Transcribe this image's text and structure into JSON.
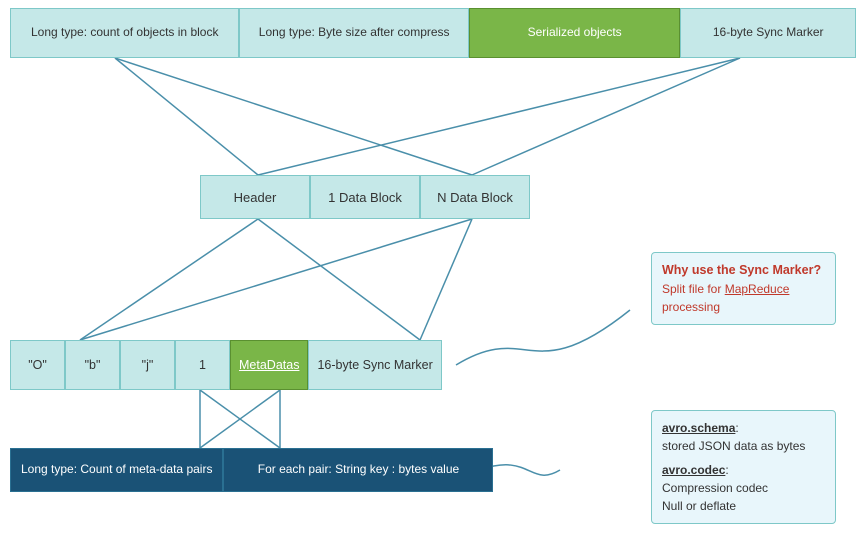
{
  "top_bar": {
    "cell1": "Long type:\ncount of objects in block",
    "cell2": "Long type:\nByte size after compress",
    "cell3": "Serialized objects",
    "cell4": "16-byte Sync Marker"
  },
  "middle_bar": {
    "cell1": "Header",
    "cell2": "1 Data Block",
    "cell3": "N Data Block"
  },
  "bottom_bar": {
    "cell1": "\"O\"",
    "cell2": "\"b\"",
    "cell3": "\"j\"",
    "cell4": "1",
    "cell5": "MetaDatas",
    "cell6": "16-byte Sync Marker"
  },
  "meta_bar": {
    "cell1": "Long type:\nCount of meta-data pairs",
    "cell2": "For each pair:\nString key : bytes value"
  },
  "callout_sync": {
    "title": "Why use the Sync Marker?",
    "body": "Split file for ",
    "link": "MapReduce",
    "body2": " processing"
  },
  "callout_avro": {
    "line1_kw": "avro.schema",
    "line1_rest": ":\nstored JSON data as bytes",
    "line2_kw": "avro.codec",
    "line2_rest": ":\nCompression codec\nNull or deflate"
  }
}
